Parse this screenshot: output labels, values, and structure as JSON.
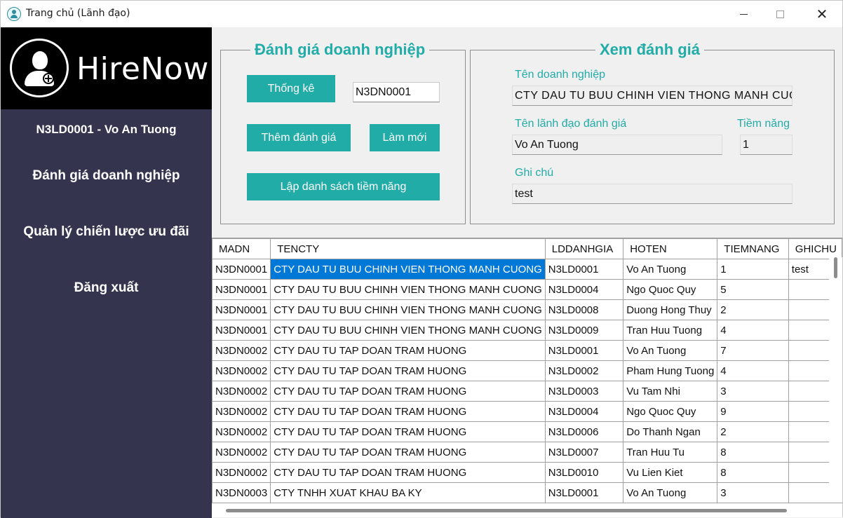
{
  "window": {
    "title": "Trang chủ (Lãnh đạo)"
  },
  "brand": {
    "name": "HireNow"
  },
  "sidebar": {
    "user": "N3LD0001 - Vo An Tuong",
    "items": [
      {
        "label": "Đánh giá doanh nghiệp"
      },
      {
        "label": "Quản lý chiến lược ưu đãi"
      },
      {
        "label": "Đăng xuất"
      }
    ]
  },
  "evaluate": {
    "legend": "Đánh giá doanh nghiệp",
    "stats_button": "Thống kê",
    "madn_value": "N3DN0001",
    "add_button": "Thêm đánh giá",
    "refresh_button": "Làm mới",
    "potential_list_button": "Lập danh sách tiềm năng"
  },
  "view": {
    "legend": "Xem đánh giá",
    "company_label": "Tên doanh nghiệp",
    "company_value": "CTY DAU TU BUU CHINH VIEN THONG MANH CUONG",
    "leader_label": "Tên lãnh đạo đánh giá",
    "leader_value": "Vo An Tuong",
    "potential_label": "Tiềm năng",
    "potential_value": "1",
    "note_label": "Ghi chú",
    "note_value": "test"
  },
  "table": {
    "columns": [
      "MADN",
      "TENCTY",
      "LDDANHGIA",
      "HOTEN",
      "TIEMNANG",
      "GHICHU"
    ],
    "rows": [
      [
        "N3DN0001",
        "CTY DAU TU BUU CHINH VIEN THONG MANH CUONG",
        "N3LD0001",
        "Vo An Tuong",
        "1",
        "test"
      ],
      [
        "N3DN0001",
        "CTY DAU TU BUU CHINH VIEN THONG MANH CUONG",
        "N3LD0004",
        "Ngo Quoc Quy",
        "5",
        ""
      ],
      [
        "N3DN0001",
        "CTY DAU TU BUU CHINH VIEN THONG MANH CUONG",
        "N3LD0008",
        "Duong Hong Thuy",
        "2",
        ""
      ],
      [
        "N3DN0001",
        "CTY DAU TU BUU CHINH VIEN THONG MANH CUONG",
        "N3LD0009",
        "Tran Huu Tuong",
        "4",
        ""
      ],
      [
        "N3DN0002",
        "CTY DAU TU TAP DOAN TRAM HUONG",
        "N3LD0001",
        "Vo An Tuong",
        "7",
        ""
      ],
      [
        "N3DN0002",
        "CTY DAU TU TAP DOAN TRAM HUONG",
        "N3LD0002",
        "Pham Hung Tuong",
        "4",
        ""
      ],
      [
        "N3DN0002",
        "CTY DAU TU TAP DOAN TRAM HUONG",
        "N3LD0003",
        "Vu Tam Nhi",
        "3",
        ""
      ],
      [
        "N3DN0002",
        "CTY DAU TU TAP DOAN TRAM HUONG",
        "N3LD0004",
        "Ngo Quoc Quy",
        "9",
        ""
      ],
      [
        "N3DN0002",
        "CTY DAU TU TAP DOAN TRAM HUONG",
        "N3LD0006",
        "Do Thanh Ngan",
        "2",
        ""
      ],
      [
        "N3DN0002",
        "CTY DAU TU TAP DOAN TRAM HUONG",
        "N3LD0007",
        "Tran Huu Tu",
        "8",
        ""
      ],
      [
        "N3DN0002",
        "CTY DAU TU TAP DOAN TRAM HUONG",
        "N3LD0010",
        "Vu Lien Kiet",
        "8",
        ""
      ],
      [
        "N3DN0003",
        "CTY TNHH XUAT KHAU BA KY",
        "N3LD0001",
        "Vo An Tuong",
        "3",
        ""
      ]
    ]
  },
  "colors": {
    "accent": "#22aca8",
    "sidebar": "#34344e",
    "selection": "#0078d7"
  },
  "icons": {
    "app": "user-add-icon",
    "minimize": "minimize-icon",
    "maximize": "maximize-icon",
    "close": "close-icon"
  }
}
